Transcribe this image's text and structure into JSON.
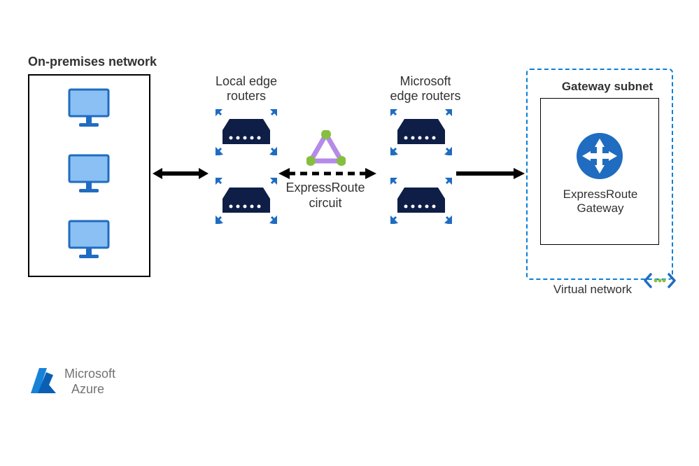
{
  "onprem": {
    "title": "On-premises network"
  },
  "localRouters": {
    "label1": "Local edge",
    "label2": "routers"
  },
  "msRouters": {
    "label1": "Microsoft",
    "label2": "edge routers"
  },
  "circuit": {
    "label1": "ExpressRoute",
    "label2": "circuit"
  },
  "gateway": {
    "title": "Gateway subnet",
    "label1": "ExpressRoute",
    "label2": "Gateway"
  },
  "vnet": {
    "label": "Virtual network"
  },
  "azure": {
    "line1": "Microsoft",
    "line2": "Azure"
  }
}
